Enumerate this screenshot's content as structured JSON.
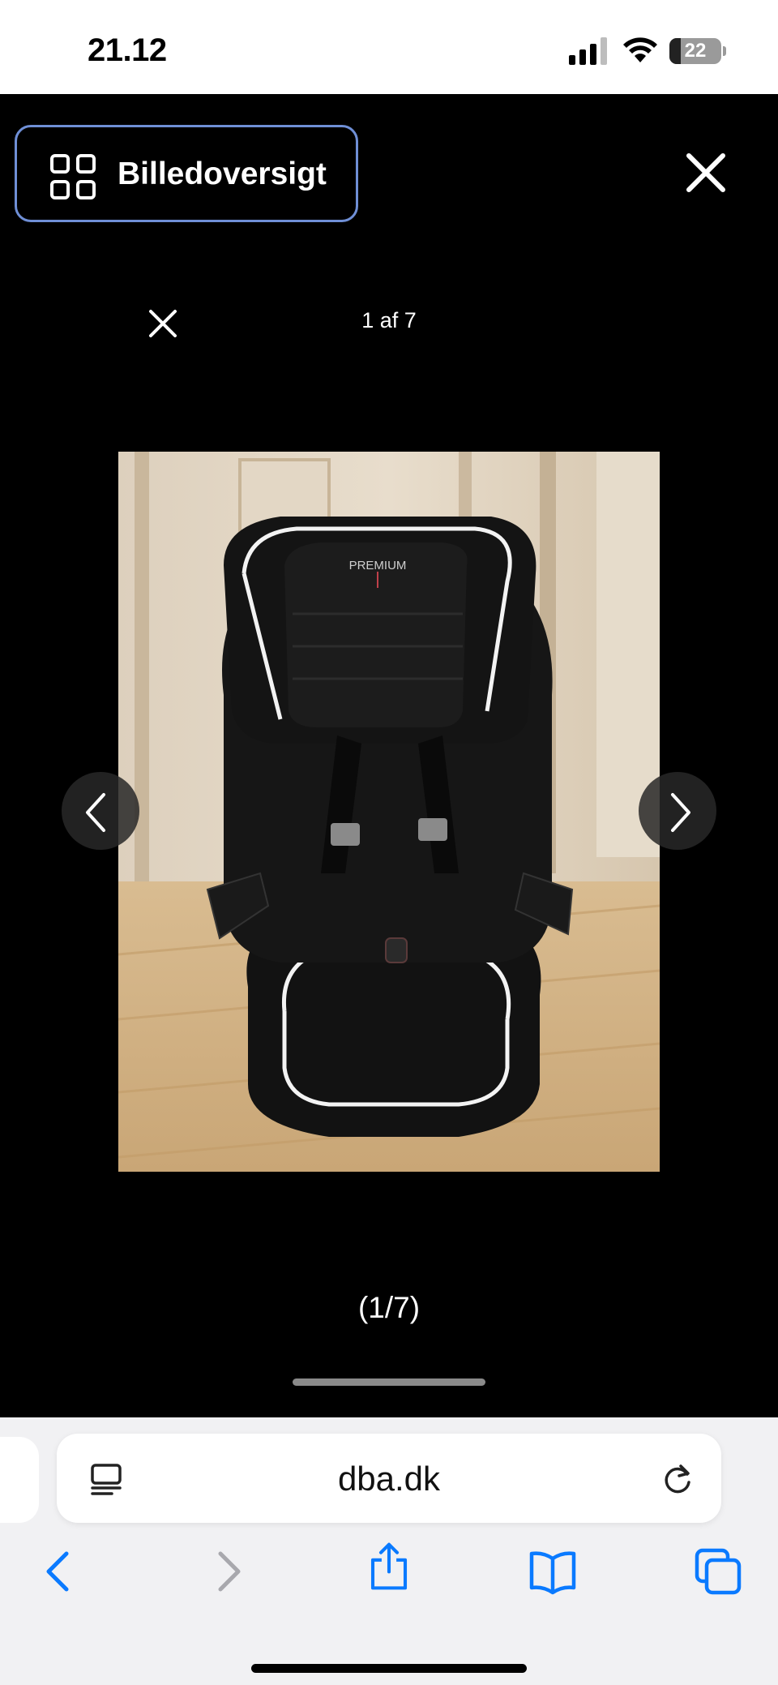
{
  "status_bar": {
    "time": "21.12",
    "battery_level": "22",
    "battery_fraction": 0.22
  },
  "viewer": {
    "overview_label": "Billedoversigt",
    "close_label": "close-icon",
    "counter_top": "1 af 7",
    "counter_bottom": "(1/7)",
    "photo_text": "PREMIUM",
    "accent_color": "#6f8fd6"
  },
  "browser": {
    "url": "dba.dk",
    "icons": [
      "reader-icon",
      "reload-icon",
      "back-icon",
      "forward-icon",
      "share-icon",
      "bookmarks-icon",
      "tabs-icon"
    ],
    "accent_color": "#0a7aff"
  }
}
